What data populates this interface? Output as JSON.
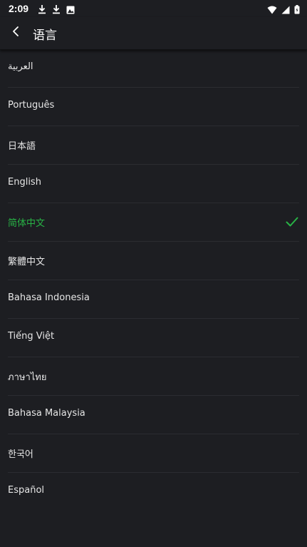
{
  "status_bar": {
    "time": "2:09",
    "left_icons": [
      "download-icon",
      "download-icon",
      "photo-icon"
    ],
    "right_icons": [
      "wifi-icon",
      "signal-icon",
      "battery-icon"
    ]
  },
  "app_bar": {
    "back_icon": "back-arrow-icon",
    "title": "语言"
  },
  "languages": [
    {
      "label": "العربية",
      "selected": false
    },
    {
      "label": "Português",
      "selected": false
    },
    {
      "label": "日本語",
      "selected": false
    },
    {
      "label": "English",
      "selected": false
    },
    {
      "label": "简体中文",
      "selected": true
    },
    {
      "label": "繁體中文",
      "selected": false
    },
    {
      "label": "Bahasa Indonesia",
      "selected": false
    },
    {
      "label": "Tiếng Việt",
      "selected": false
    },
    {
      "label": "ภาษาไทย",
      "selected": false
    },
    {
      "label": "Bahasa Malaysia",
      "selected": false
    },
    {
      "label": "한국어",
      "selected": false
    },
    {
      "label": "Español",
      "selected": false
    }
  ],
  "colors": {
    "background": "#1d1e22",
    "accent": "#28b446",
    "divider": "#2b2c31"
  }
}
